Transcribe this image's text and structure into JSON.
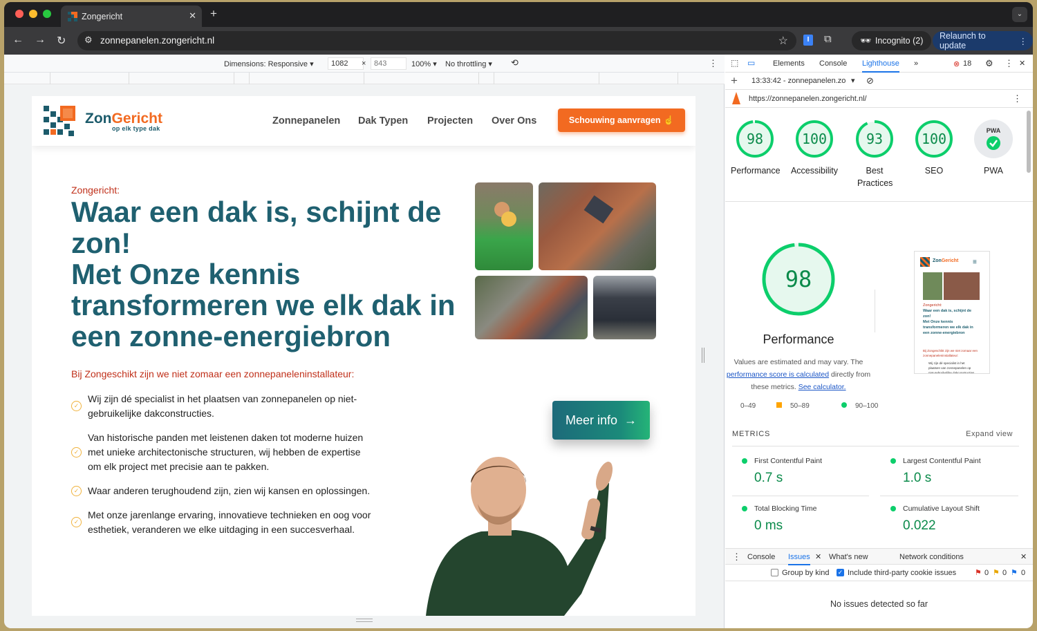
{
  "browser": {
    "tab_title": "Zongericht",
    "url": "zonnepanelen.zongericht.nl",
    "incognito_label": "Incognito (2)",
    "relaunch_label": "Relaunch to update"
  },
  "device_toolbar": {
    "dimensions_label": "Dimensions: Responsive",
    "width": "1082",
    "height": "843",
    "zoom": "100%",
    "throttling": "No throttling"
  },
  "site": {
    "logo_main": "Zon",
    "logo_accent": "Gericht",
    "logo_tagline": "op elk type dak",
    "nav": [
      "Zonnepanelen",
      "Dak Typen",
      "Projecten",
      "Over Ons"
    ],
    "cta_label": "Schouwing aanvragen",
    "kicker": "Zongericht:",
    "headline_1": "Waar een dak is, schijnt de zon!",
    "headline_2": "Met Onze kennis transformeren we elk dak in een zonne-energiebron",
    "intro": "Bij Zongeschikt zijn we niet zomaar een zonnepaneleninstallateur:",
    "bullets": [
      "Wij zijn dé specialist in het plaatsen van zonnepanelen op niet-gebruikelijke dakconstructies.",
      "Van historische panden met leistenen daken tot moderne huizen met unieke architectonische structuren, wij hebben de expertise om elk project met precisie aan te pakken.",
      "Waar anderen terughoudend zijn, zien wij kansen en oplossingen.",
      "Met onze jarenlange ervaring, innovatieve technieken en oog voor esthetiek, veranderen we elke uitdaging in een succesverhaal."
    ],
    "meer_info": "Meer info"
  },
  "devtools": {
    "tabs": [
      "Elements",
      "Console",
      "Lighthouse"
    ],
    "active_tab": "Lighthouse",
    "error_count": "18",
    "report_time": "13:33:42 - zonnepanelen.zo",
    "report_url": "https://zonnepanelen.zongericht.nl/",
    "scores": [
      {
        "value": "98",
        "label": "Performance"
      },
      {
        "value": "100",
        "label": "Accessibility"
      },
      {
        "value": "93",
        "label": "Best Practices"
      },
      {
        "value": "100",
        "label": "SEO"
      }
    ],
    "pwa_label": "PWA",
    "pwa_badge": "PWA",
    "perf_score": "98",
    "perf_title": "Performance",
    "perf_note_1": "Values are estimated and may vary. The",
    "perf_note_link1": "performance score is calculated",
    "perf_note_2": "directly from",
    "perf_note_3": "these metrics.",
    "perf_note_link2": "See calculator.",
    "legend": [
      "0–49",
      "50–89",
      "90–100"
    ],
    "metrics_header": "METRICS",
    "expand_view": "Expand view",
    "metrics": [
      {
        "name": "First Contentful Paint",
        "value": "0.7 s"
      },
      {
        "name": "Largest Contentful Paint",
        "value": "1.0 s"
      },
      {
        "name": "Total Blocking Time",
        "value": "0 ms"
      },
      {
        "name": "Cumulative Layout Shift",
        "value": "0.022"
      }
    ],
    "drawer_tabs": [
      "Console",
      "Issues",
      "What's new",
      "Network conditions"
    ],
    "group_by_kind": "Group by kind",
    "include_third_party": "Include third-party cookie issues",
    "issue_counts": [
      "0",
      "0",
      "0"
    ],
    "no_issues": "No issues detected so far"
  },
  "colors": {
    "brand_teal": "#1f6070",
    "brand_orange": "#f26a21",
    "score_green": "#0cce6b"
  }
}
